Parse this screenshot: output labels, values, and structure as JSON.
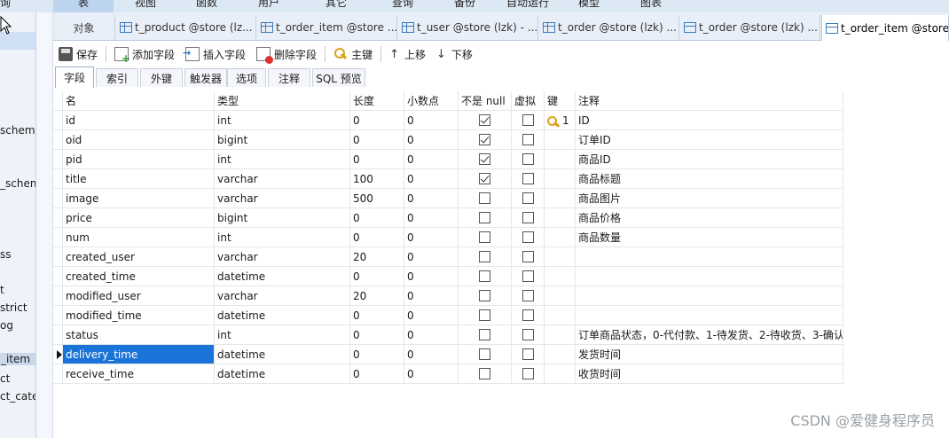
{
  "menubar": {
    "items": [
      "表",
      "视图",
      "函数",
      "用户",
      "其它",
      "查询",
      "备份",
      "自动运行",
      "模型",
      "图表"
    ],
    "left_fragment": "询"
  },
  "left_nav": {
    "items": [
      {
        "label": "schema",
        "active": false
      },
      {
        "label": "_schem",
        "active": false
      },
      {
        "label": "ss",
        "active": false
      },
      {
        "label": "t",
        "active": false
      },
      {
        "label": "strict",
        "active": false
      },
      {
        "label": "og",
        "active": false
      },
      {
        "label": "_item",
        "active": true
      },
      {
        "label": "ct",
        "active": false
      },
      {
        "label": "ct_cate",
        "active": false
      }
    ]
  },
  "tabs": [
    {
      "label": "对象",
      "icon": "",
      "active": false
    },
    {
      "label": "t_product @store (lz...",
      "icon": "table-icon",
      "active": false
    },
    {
      "label": "t_order_item @store ...",
      "icon": "table-icon",
      "active": false
    },
    {
      "label": "t_user @store (lzk) - ...",
      "icon": "table-icon",
      "active": false
    },
    {
      "label": "t_order @store (lzk) ...",
      "icon": "table-icon",
      "active": false
    },
    {
      "label": "t_order @store (lzk) ...",
      "icon": "table-edit-icon",
      "active": false
    },
    {
      "label": "t_order_item @store",
      "icon": "table-edit-icon",
      "active": true
    }
  ],
  "toolbar": {
    "save": "保存",
    "add_field": "添加字段",
    "insert_field": "插入字段",
    "delete_field": "删除字段",
    "primary_key": "主键",
    "move_up": "上移",
    "move_down": "下移"
  },
  "subtabs": [
    {
      "label": "字段",
      "active": true
    },
    {
      "label": "索引",
      "active": false
    },
    {
      "label": "外键",
      "active": false
    },
    {
      "label": "触发器",
      "active": false
    },
    {
      "label": "选项",
      "active": false
    },
    {
      "label": "注释",
      "active": false
    },
    {
      "label": "SQL 预览",
      "active": false
    }
  ],
  "grid": {
    "headers": {
      "name": "名",
      "type": "类型",
      "length": "长度",
      "decimals": "小数点",
      "not_null": "不是 null",
      "virtual": "虚拟",
      "key": "键",
      "comment": "注释"
    },
    "rows": [
      {
        "name": "id",
        "type": "int",
        "length": "0",
        "decimals": "0",
        "not_null": true,
        "virtual": false,
        "key": "1",
        "comment": "ID"
      },
      {
        "name": "oid",
        "type": "bigint",
        "length": "0",
        "decimals": "0",
        "not_null": true,
        "virtual": false,
        "key": "",
        "comment": "订单ID"
      },
      {
        "name": "pid",
        "type": "int",
        "length": "0",
        "decimals": "0",
        "not_null": true,
        "virtual": false,
        "key": "",
        "comment": "商品ID"
      },
      {
        "name": "title",
        "type": "varchar",
        "length": "100",
        "decimals": "0",
        "not_null": true,
        "virtual": false,
        "key": "",
        "comment": "商品标题"
      },
      {
        "name": "image",
        "type": "varchar",
        "length": "500",
        "decimals": "0",
        "not_null": false,
        "virtual": false,
        "key": "",
        "comment": "商品图片"
      },
      {
        "name": "price",
        "type": "bigint",
        "length": "0",
        "decimals": "0",
        "not_null": false,
        "virtual": false,
        "key": "",
        "comment": "商品价格"
      },
      {
        "name": "num",
        "type": "int",
        "length": "0",
        "decimals": "0",
        "not_null": false,
        "virtual": false,
        "key": "",
        "comment": "商品数量"
      },
      {
        "name": "created_user",
        "type": "varchar",
        "length": "20",
        "decimals": "0",
        "not_null": false,
        "virtual": false,
        "key": "",
        "comment": ""
      },
      {
        "name": "created_time",
        "type": "datetime",
        "length": "0",
        "decimals": "0",
        "not_null": false,
        "virtual": false,
        "key": "",
        "comment": ""
      },
      {
        "name": "modified_user",
        "type": "varchar",
        "length": "20",
        "decimals": "0",
        "not_null": false,
        "virtual": false,
        "key": "",
        "comment": ""
      },
      {
        "name": "modified_time",
        "type": "datetime",
        "length": "0",
        "decimals": "0",
        "not_null": false,
        "virtual": false,
        "key": "",
        "comment": ""
      },
      {
        "name": "status",
        "type": "int",
        "length": "0",
        "decimals": "0",
        "not_null": false,
        "virtual": false,
        "key": "",
        "comment": "订单商品状态，0-代付款、1-待发货、2-待收货、3-确认"
      },
      {
        "name": "delivery_time",
        "type": "datetime",
        "length": "0",
        "decimals": "0",
        "not_null": false,
        "virtual": false,
        "key": "",
        "comment": "发货时间",
        "selected": true
      },
      {
        "name": "receive_time",
        "type": "datetime",
        "length": "0",
        "decimals": "0",
        "not_null": false,
        "virtual": false,
        "key": "",
        "comment": "收货时间"
      }
    ]
  },
  "watermark": "CSDN @爱健身程序员",
  "colors": {
    "selection": "#1a73d6",
    "tab_bg": "#e9eff8",
    "key_gold": "#d8a21a"
  }
}
